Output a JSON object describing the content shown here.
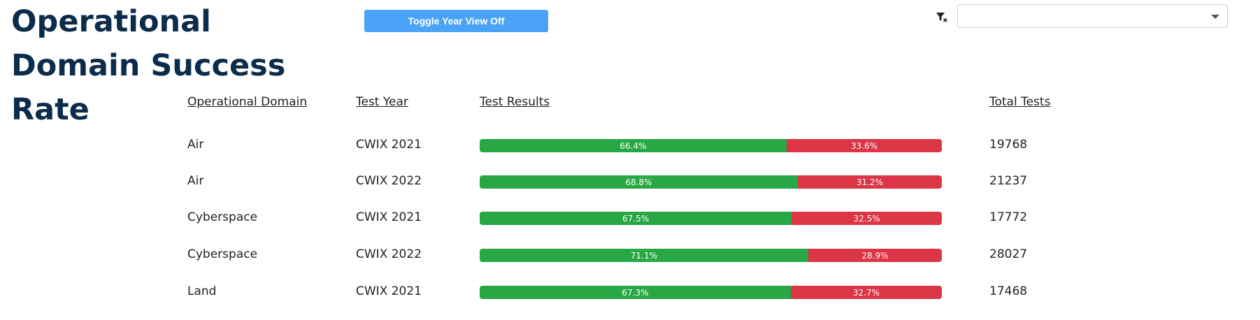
{
  "page": {
    "title": "Operational Domain Success Rate"
  },
  "toolbar": {
    "toggle_label": "Toggle Year View Off",
    "filter_clear_icon": "filter-clear-icon",
    "select_value": ""
  },
  "colors": {
    "title": "#0c2c4c",
    "button": "#4aa3f7",
    "pass": "#28a745",
    "fail": "#dc3545"
  },
  "table": {
    "headers": {
      "domain": "Operational Domain",
      "year": "Test Year",
      "results": "Test Results",
      "total": "Total Tests"
    },
    "rows": [
      {
        "domain": "Air",
        "year": "CWIX 2021",
        "pass_pct": 66.4,
        "pass_label": "66.4%",
        "fail_pct": 33.6,
        "fail_label": "33.6%",
        "total": "19768"
      },
      {
        "domain": "Air",
        "year": "CWIX 2022",
        "pass_pct": 68.8,
        "pass_label": "68.8%",
        "fail_pct": 31.2,
        "fail_label": "31.2%",
        "total": "21237"
      },
      {
        "domain": "Cyberspace",
        "year": "CWIX 2021",
        "pass_pct": 67.5,
        "pass_label": "67.5%",
        "fail_pct": 32.5,
        "fail_label": "32.5%",
        "total": "17772"
      },
      {
        "domain": "Cyberspace",
        "year": "CWIX 2022",
        "pass_pct": 71.1,
        "pass_label": "71.1%",
        "fail_pct": 28.9,
        "fail_label": "28.9%",
        "total": "28027"
      },
      {
        "domain": "Land",
        "year": "CWIX 2021",
        "pass_pct": 67.3,
        "pass_label": "67.3%",
        "fail_pct": 32.7,
        "fail_label": "32.7%",
        "total": "17468"
      }
    ]
  }
}
